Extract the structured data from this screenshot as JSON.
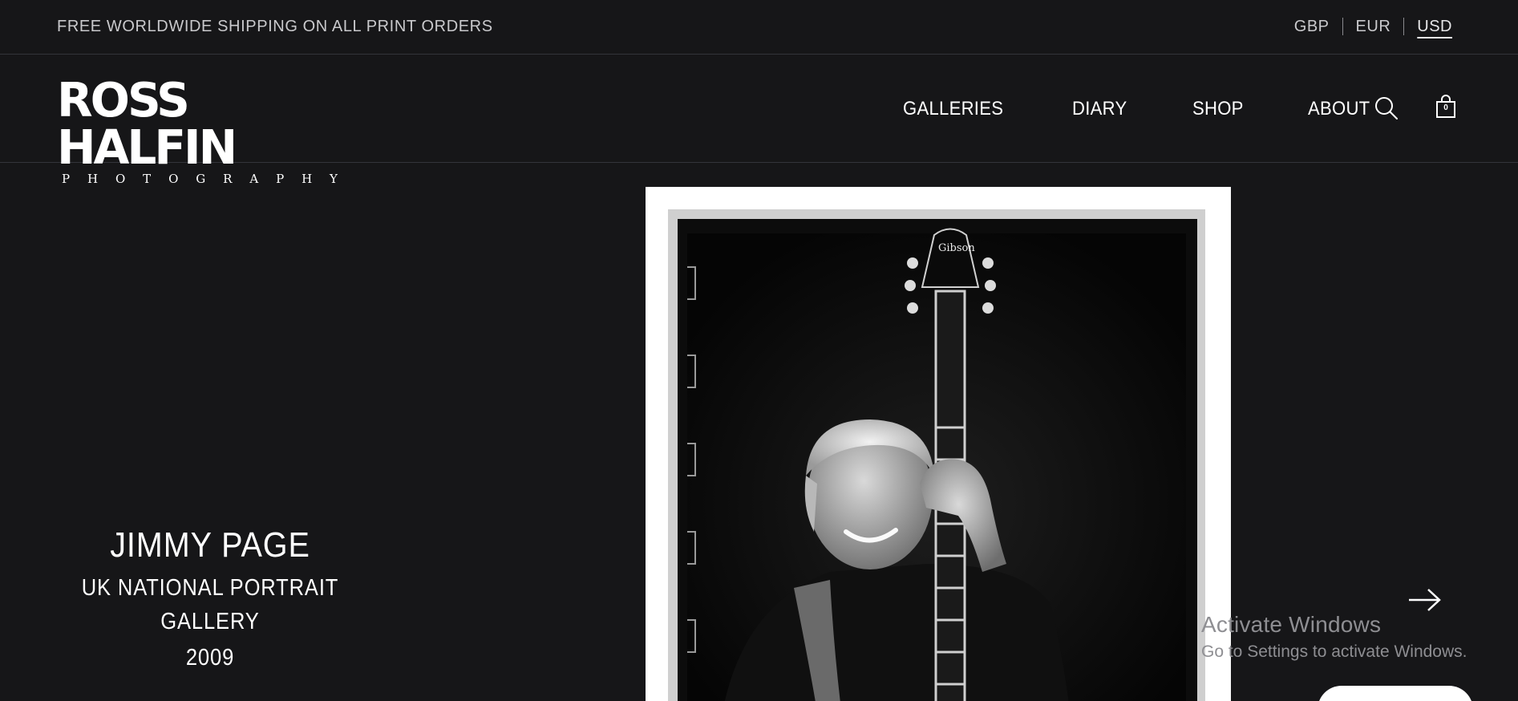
{
  "topbar": {
    "shipping_text": "FREE WORLDWIDE SHIPPING ON ALL PRINT ORDERS",
    "currencies": [
      "GBP",
      "EUR",
      "USD"
    ],
    "active_currency": "USD"
  },
  "header": {
    "logo_main": "ROSS HALFIN",
    "logo_sub": [
      "P",
      "H",
      "O",
      "T",
      "O",
      "G",
      "R",
      "A",
      "P",
      "H",
      "Y"
    ],
    "nav": [
      "GALLERIES",
      "DIARY",
      "SHOP",
      "ABOUT"
    ],
    "search_icon": "search-icon",
    "cart_icon": "shopping-bag-icon",
    "cart_count": "0"
  },
  "hero": {
    "title": "JIMMY PAGE",
    "subtitle_line1": "UK NATIONAL PORTRAIT",
    "subtitle_line2": "GALLERY",
    "year": "2009",
    "photo_alt": "Black and white photograph of Jimmy Page smiling, holding a Gibson guitar",
    "guitar_brand": "Gibson",
    "next_icon": "arrow-right-icon"
  },
  "watermark": {
    "title": "Activate Windows",
    "subtitle": "Go to Settings to activate Windows."
  },
  "colors": {
    "background": "#161618",
    "divider": "#33343a",
    "text_primary": "#ffffff",
    "text_muted": "#c9c9cc"
  }
}
